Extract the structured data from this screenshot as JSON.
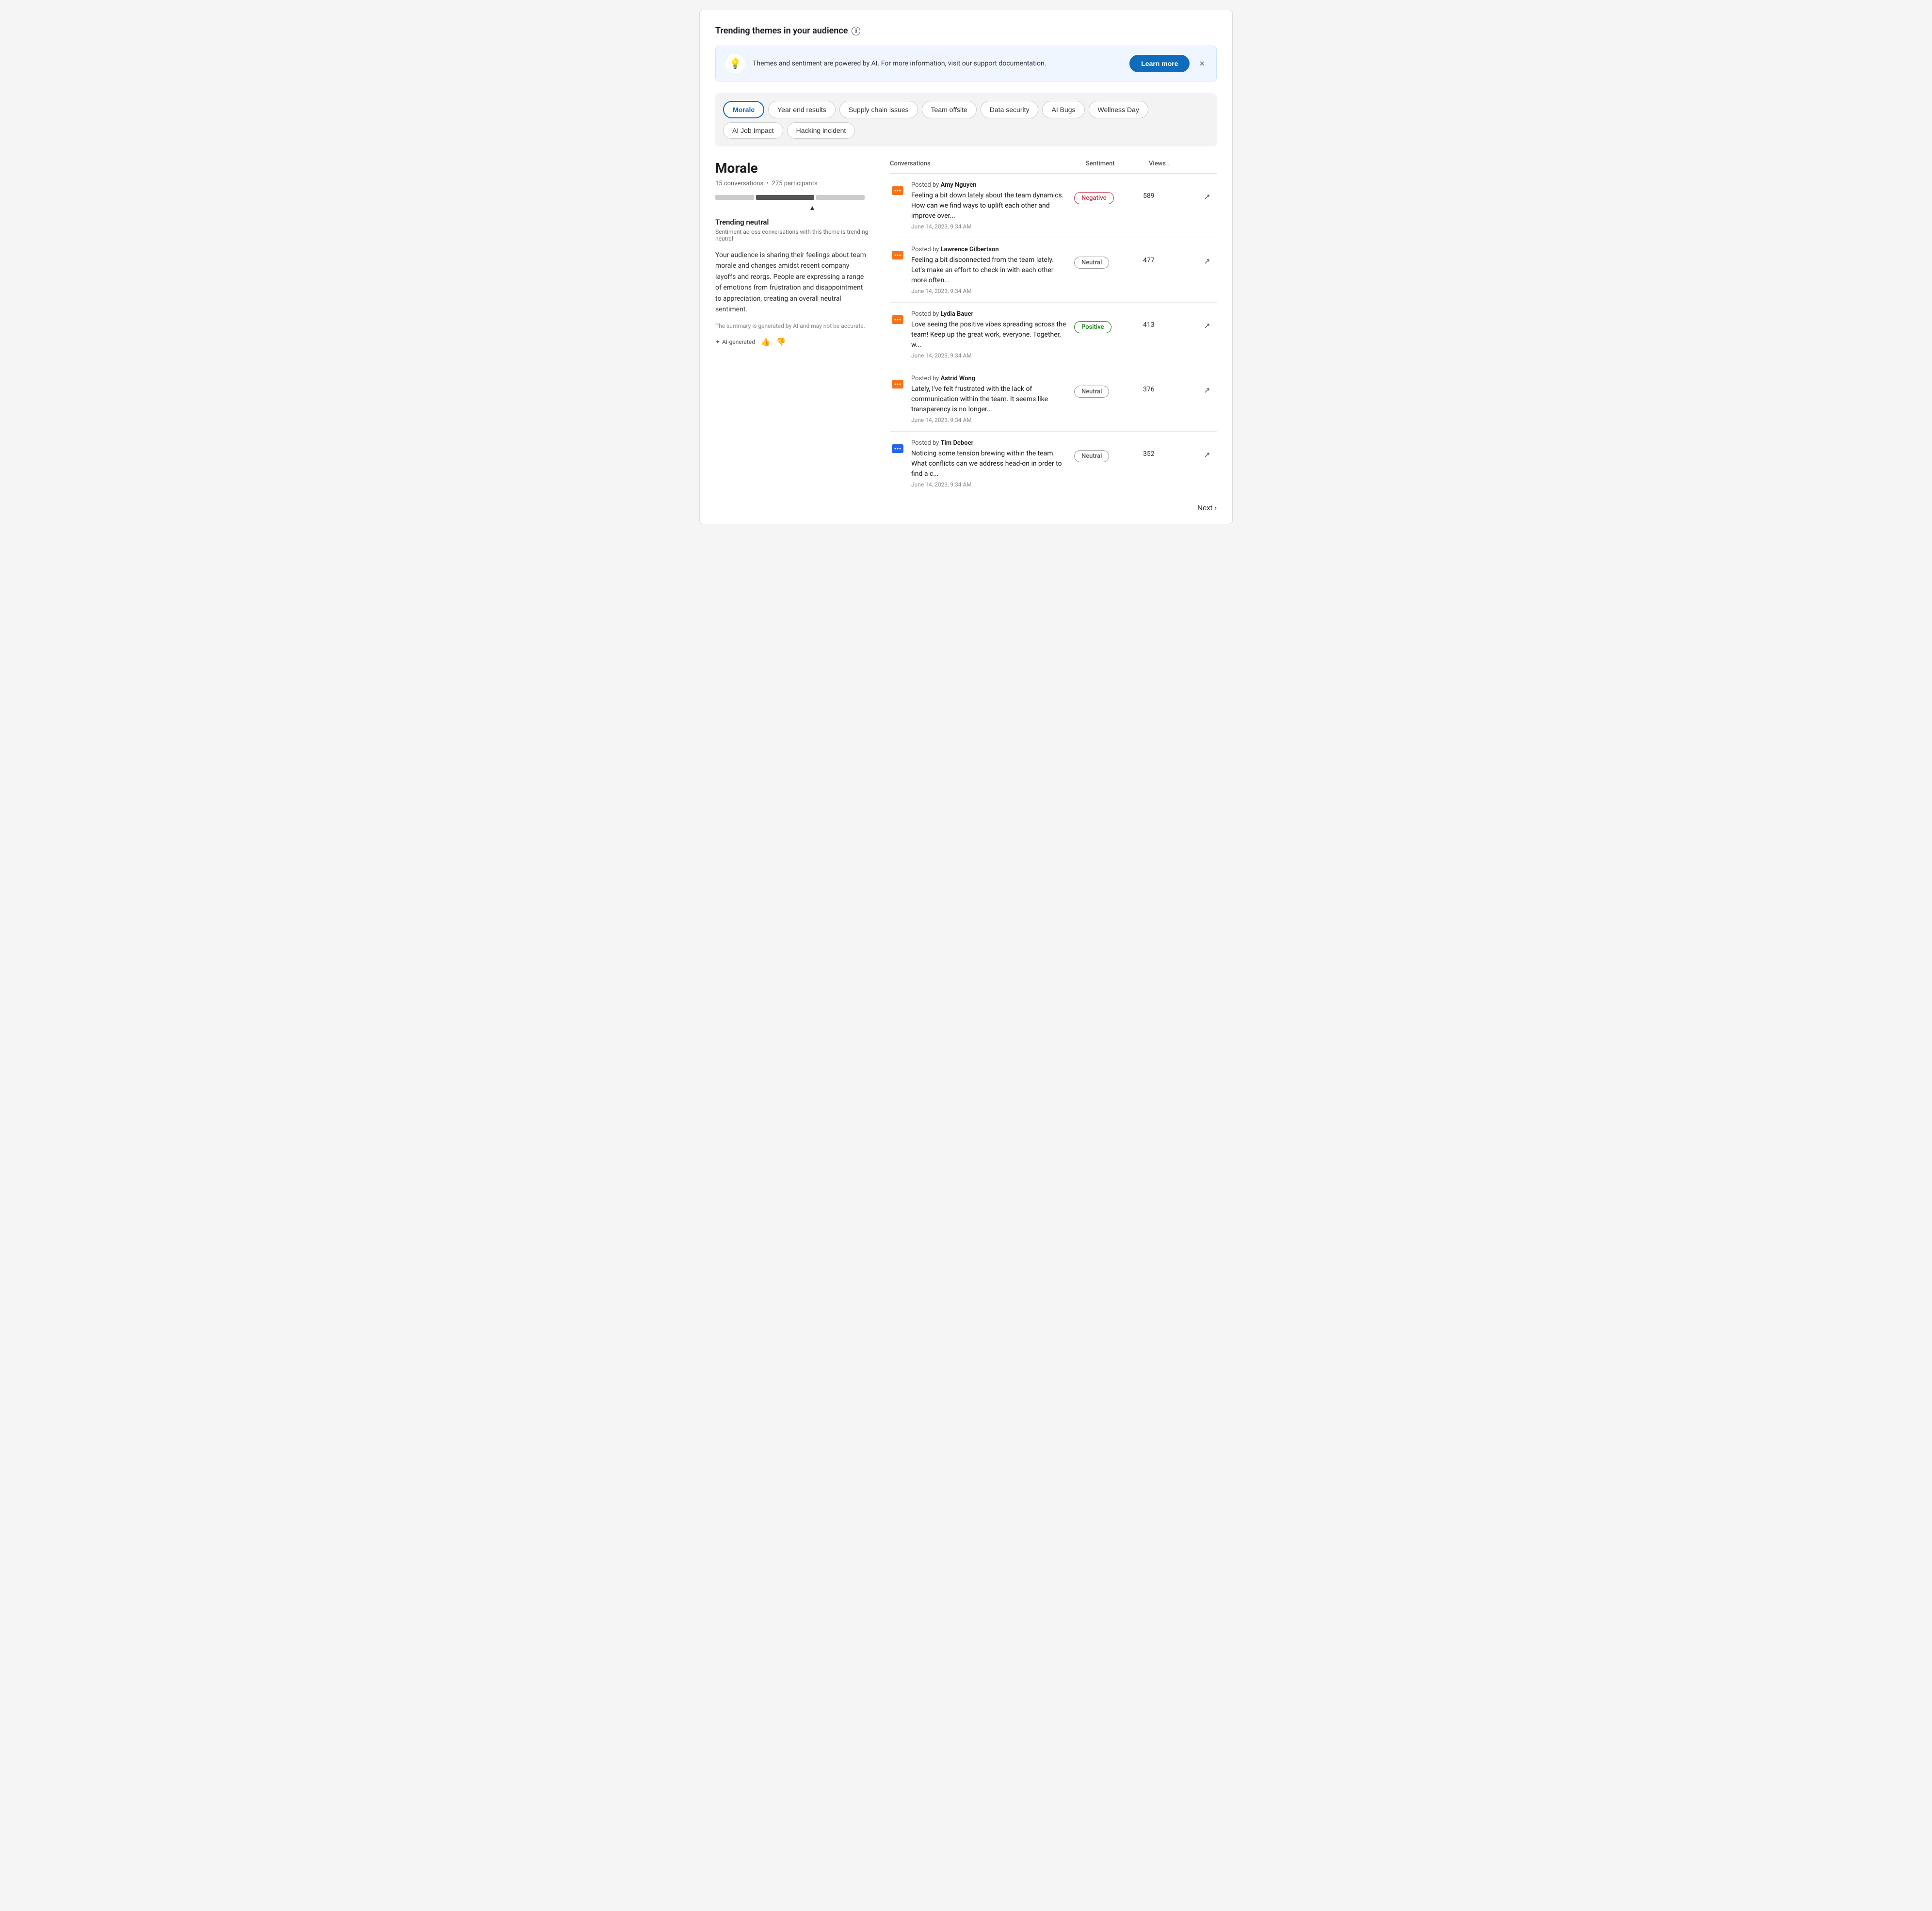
{
  "page": {
    "title": "Trending themes in your audience",
    "info_icon": "ℹ"
  },
  "banner": {
    "icon": "💡",
    "text": "Themes and sentiment are powered by AI. For more information, visit our support documentation.",
    "learn_more_label": "Learn more",
    "close_label": "×"
  },
  "themes": {
    "tabs": [
      {
        "label": "Morale",
        "active": true
      },
      {
        "label": "Year end results",
        "active": false
      },
      {
        "label": "Supply chain issues",
        "active": false
      },
      {
        "label": "Team offsite",
        "active": false
      },
      {
        "label": "Data security",
        "active": false
      },
      {
        "label": "AI Bugs",
        "active": false
      },
      {
        "label": "Wellness Day",
        "active": false
      },
      {
        "label": "AI Job Impact",
        "active": false
      },
      {
        "label": "Hacking incident",
        "active": false
      }
    ]
  },
  "selected_theme": {
    "title": "Morale",
    "conversations_count": "15 conversations",
    "participants_count": "275 participants",
    "trending_label": "Trending neutral",
    "trending_sub": "Sentiment across conversations with this theme is trending neutral",
    "description": "Your audience is sharing their feelings about team morale and changes amidst recent company layoffs and reorgs. People are expressing a range of emotions from frustration and disappointment to appreciation, creating an overall neutral sentiment.",
    "ai_disclaimer": "The summary is generated by AI and may not be accurate.",
    "ai_generated_label": "AI-generated",
    "thumbs_up_label": "👍",
    "thumbs_down_label": "👎"
  },
  "table": {
    "col_conversations": "Conversations",
    "col_sentiment": "Sentiment",
    "col_views": "Views",
    "sort_arrow": "↓"
  },
  "conversations": [
    {
      "author": "Amy Nguyen",
      "icon": "🟠",
      "icon_type": "chat-orange",
      "text": "Feeling a bit down lately about the team dynamics. How can we find ways to uplift each other and improve over...",
      "sentiment": "Negative",
      "sentiment_type": "negative",
      "views": "589",
      "date": "June 14, 2023, 9:34 AM"
    },
    {
      "author": "Lawrence Gilbertson",
      "icon": "🟠",
      "icon_type": "chat-orange",
      "text": "Feeling a bit disconnected from the team lately. Let's make an effort to check in with each other more often...",
      "sentiment": "Neutral",
      "sentiment_type": "neutral",
      "views": "477",
      "date": "June 14, 2023, 9:34 AM"
    },
    {
      "author": "Lydia Bauer",
      "icon": "🟠",
      "icon_type": "chat-orange",
      "text": "Love seeing the positive vibes spreading across the team! Keep up the great work, everyone. Together, w...",
      "sentiment": "Positive",
      "sentiment_type": "positive",
      "views": "413",
      "date": "June 14, 2023, 9:34 AM"
    },
    {
      "author": "Astrid Wong",
      "icon": "🟠",
      "icon_type": "chat-orange",
      "text": "Lately, I've felt frustrated with the lack of communication within the team. It seems like transparency is no longer...",
      "sentiment": "Neutral",
      "sentiment_type": "neutral",
      "views": "376",
      "date": "June 14, 2023, 9:34 AM"
    },
    {
      "author": "Tim Deboer",
      "icon": "🔵",
      "icon_type": "chat-blue",
      "text": "Noticing some tension brewing within the team. What conflicts can we address head-on in order to find a c...",
      "sentiment": "Neutral",
      "sentiment_type": "neutral",
      "views": "352",
      "date": "June 14, 2023, 9:34 AM"
    }
  ],
  "pagination": {
    "next_label": "Next",
    "next_arrow": "›"
  }
}
